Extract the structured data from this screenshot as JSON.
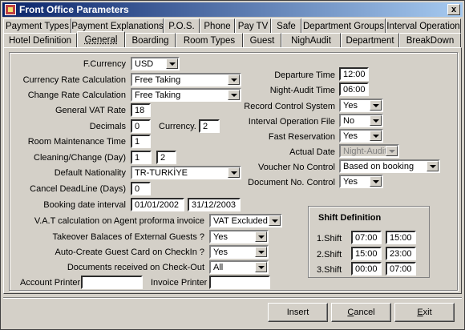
{
  "window": {
    "title": "Front Office Parameters",
    "close_glyph": "x"
  },
  "tabs_row1": [
    "Payment Types",
    "Payment Explanations",
    "P.O.S.",
    "Phone",
    "Pay TV",
    "Safe",
    "Department Groups",
    "Interval Operation"
  ],
  "tabs_row2": [
    "Hotel Definition",
    "General",
    "Boarding",
    "Room Types",
    "Guest",
    "NighAudit",
    "Department",
    "BreakDown"
  ],
  "active_tab": "General",
  "form": {
    "fcurrency": {
      "label": "F.Currency",
      "value": "USD"
    },
    "currency_rate_calc": {
      "label": "Currency Rate Calculation",
      "value": "Free Taking"
    },
    "change_rate_calc": {
      "label": "Change Rate Calculation",
      "value": "Free Taking"
    },
    "general_vat_rate": {
      "label": "General VAT Rate",
      "value": "18"
    },
    "decimals": {
      "label": "Decimals",
      "value": "0"
    },
    "currency": {
      "label": "Currency.",
      "value": "2"
    },
    "room_maintenance_time": {
      "label": "Room Maintenance Time",
      "value": "1"
    },
    "cleaning_change": {
      "label": "Cleaning/Change (Day)",
      "value1": "1",
      "value2": "2"
    },
    "default_nationality": {
      "label": "Default Nationality",
      "value": "TR-TURKİYE"
    },
    "cancel_deadline": {
      "label": "Cancel DeadLine (Days)",
      "value": "0"
    },
    "booking_date_interval": {
      "label": "Booking date interval",
      "from": "01/01/2002",
      "to": "31/12/2003"
    },
    "vat_calc": {
      "label": "V.A.T calculation on Agent proforma invoice",
      "value": "VAT Excluded"
    },
    "takeover_balances": {
      "label": "Takeover Balaces of External Guests ?",
      "value": "Yes"
    },
    "auto_create_card": {
      "label": "Auto-Create Guest Card on CheckIn ?",
      "value": "Yes"
    },
    "documents_checkout": {
      "label": "Documents received on Check-Out",
      "value": "All"
    },
    "account_printer": {
      "label": "Account Printer",
      "value": ""
    },
    "invoice_printer": {
      "label": "Invoice Printer",
      "value": ""
    },
    "departure_time": {
      "label": "Departure Time",
      "value": "12:00"
    },
    "night_audit_time": {
      "label": "Night-Audit Time",
      "value": "06:00"
    },
    "record_control_system": {
      "label": "Record Control System",
      "value": "Yes"
    },
    "interval_operation_file": {
      "label": "Interval Operation File",
      "value": "No"
    },
    "fast_reservation": {
      "label": "Fast Reservation",
      "value": "Yes"
    },
    "actual_date": {
      "label": "Actual Date",
      "value": "Night-Audit"
    },
    "voucher_no_control": {
      "label": "Voucher No Control",
      "value": "Based on booking"
    },
    "document_no_control": {
      "label": "Document No. Control",
      "value": "Yes"
    }
  },
  "shift": {
    "title": "Shift Definition",
    "rows": [
      {
        "label": "1.Shift",
        "start": "07:00",
        "end": "15:00"
      },
      {
        "label": "2.Shift",
        "start": "15:00",
        "end": "23:00"
      },
      {
        "label": "3.Shift",
        "start": "00:00",
        "end": "07:00"
      }
    ]
  },
  "buttons": {
    "insert": "Insert",
    "cancel_first": "C",
    "cancel_rest": "ancel",
    "exit_first": "E",
    "exit_rest": "xit"
  }
}
